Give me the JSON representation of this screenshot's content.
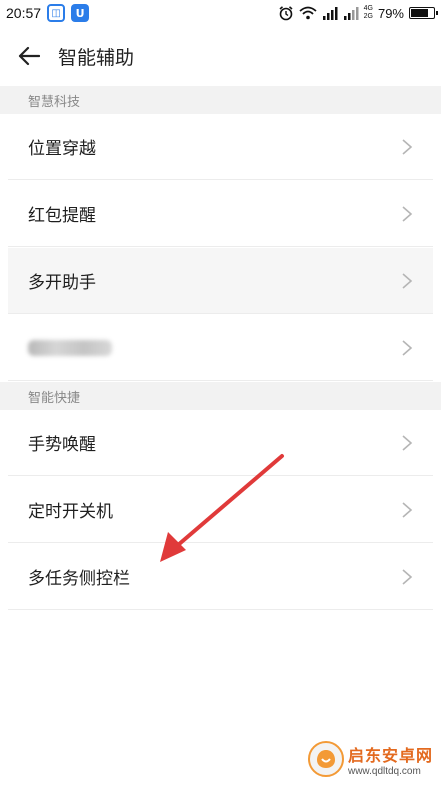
{
  "status_bar": {
    "time": "20:57",
    "network": [
      "4G",
      "2G"
    ],
    "battery": "79%",
    "battery_level": 0.79
  },
  "header": {
    "title": "智能辅助"
  },
  "sections": [
    {
      "label": "智慧科技",
      "items": [
        {
          "label": "位置穿越"
        },
        {
          "label": "红包提醒"
        },
        {
          "label": "多开助手"
        },
        {
          "label": ""
        }
      ]
    },
    {
      "label": "智能快捷",
      "items": [
        {
          "label": "手势唤醒"
        },
        {
          "label": "定时开关机"
        },
        {
          "label": "多任务侧控栏"
        }
      ]
    }
  ],
  "watermark": {
    "name": "启东安卓网",
    "url": "www.qdltdq.com"
  },
  "colors": {
    "annotation_arrow": "#e03a3a",
    "accent": "#2b7de9"
  }
}
